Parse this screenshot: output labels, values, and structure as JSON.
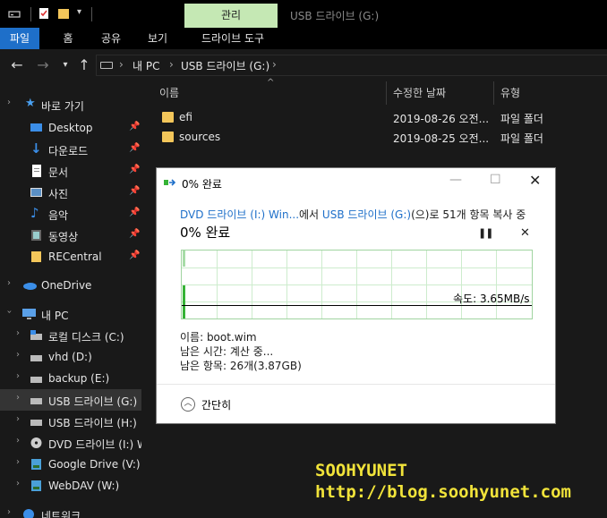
{
  "window": {
    "context_tab": "관리",
    "title": "USB 드라이브 (G:)"
  },
  "ribbon": {
    "tabs": [
      {
        "label": "파일",
        "active": true
      },
      {
        "label": "홈",
        "active": false
      },
      {
        "label": "공유",
        "active": false
      },
      {
        "label": "보기",
        "active": false
      },
      {
        "label": "드라이브 도구",
        "active": false
      }
    ]
  },
  "address": {
    "crumbs": [
      "내 PC",
      "USB 드라이브 (G:)"
    ],
    "separator": "›"
  },
  "nav": {
    "items": [
      {
        "label": "바로 가기",
        "icon": "star-icon",
        "pinned": false
      },
      {
        "label": "Desktop",
        "icon": "desktop-icon",
        "pinned": true
      },
      {
        "label": "다운로드",
        "icon": "download-icon",
        "pinned": true
      },
      {
        "label": "문서",
        "icon": "document-icon",
        "pinned": true
      },
      {
        "label": "사진",
        "icon": "picture-icon",
        "pinned": true
      },
      {
        "label": "음악",
        "icon": "music-icon",
        "pinned": true
      },
      {
        "label": "동영상",
        "icon": "video-icon",
        "pinned": true
      },
      {
        "label": "RECentral",
        "icon": "folder-icon",
        "pinned": true
      },
      {
        "label": "OneDrive",
        "icon": "cloud-icon",
        "pinned": false
      },
      {
        "label": "내 PC",
        "icon": "pc-icon",
        "pinned": false
      },
      {
        "label": "로컬 디스크 (C:)",
        "icon": "drive-icon",
        "pinned": false
      },
      {
        "label": "vhd (D:)",
        "icon": "drive-icon",
        "pinned": false
      },
      {
        "label": "backup (E:)",
        "icon": "drive-icon",
        "pinned": false
      },
      {
        "label": "USB 드라이브 (G:)",
        "icon": "drive-icon",
        "pinned": false
      },
      {
        "label": "USB 드라이브 (H:)",
        "icon": "drive-icon",
        "pinned": false
      },
      {
        "label": "DVD 드라이브 (I:) W",
        "icon": "dvd-icon",
        "pinned": false
      },
      {
        "label": "Google Drive (V:)",
        "icon": "network-drive-icon",
        "pinned": false
      },
      {
        "label": "WebDAV (W:)",
        "icon": "network-drive-icon",
        "pinned": false
      },
      {
        "label": "네트워크",
        "icon": "network-icon",
        "pinned": false
      }
    ],
    "selected": "USB 드라이브 (G:)"
  },
  "files": {
    "columns": [
      "이름",
      "수정한 날짜",
      "유형"
    ],
    "rows": [
      {
        "name": "efi",
        "date": "2019-08-26 오전...",
        "type": "파일 폴더"
      },
      {
        "name": "sources",
        "date": "2019-08-25 오전...",
        "type": "파일 폴더"
      }
    ]
  },
  "dialog": {
    "title": "0% 완료",
    "desc_source": "DVD 드라이브 (I:) Win...",
    "desc_mid": "에서 ",
    "desc_target": "USB 드라이브 (G:)",
    "desc_tail": "(으)로 51개 항목 복사 중",
    "progress_label": "0% 완료",
    "progress_percent": 0,
    "speed": "속도: 3.65MB/s",
    "name": "이름: boot.wim",
    "time_left": "남은 시간: 계산 중...",
    "items_left": "남은 항목: 26개(3.87GB)",
    "more_label": "간단히",
    "pause_icon": "pause-icon",
    "cancel_icon": "close-icon",
    "accent": "#1e6fc9",
    "graph_color": "#36b336"
  },
  "watermark": {
    "line1": "SOOHYUNET",
    "line2": "http://blog.soohyunet.com"
  }
}
